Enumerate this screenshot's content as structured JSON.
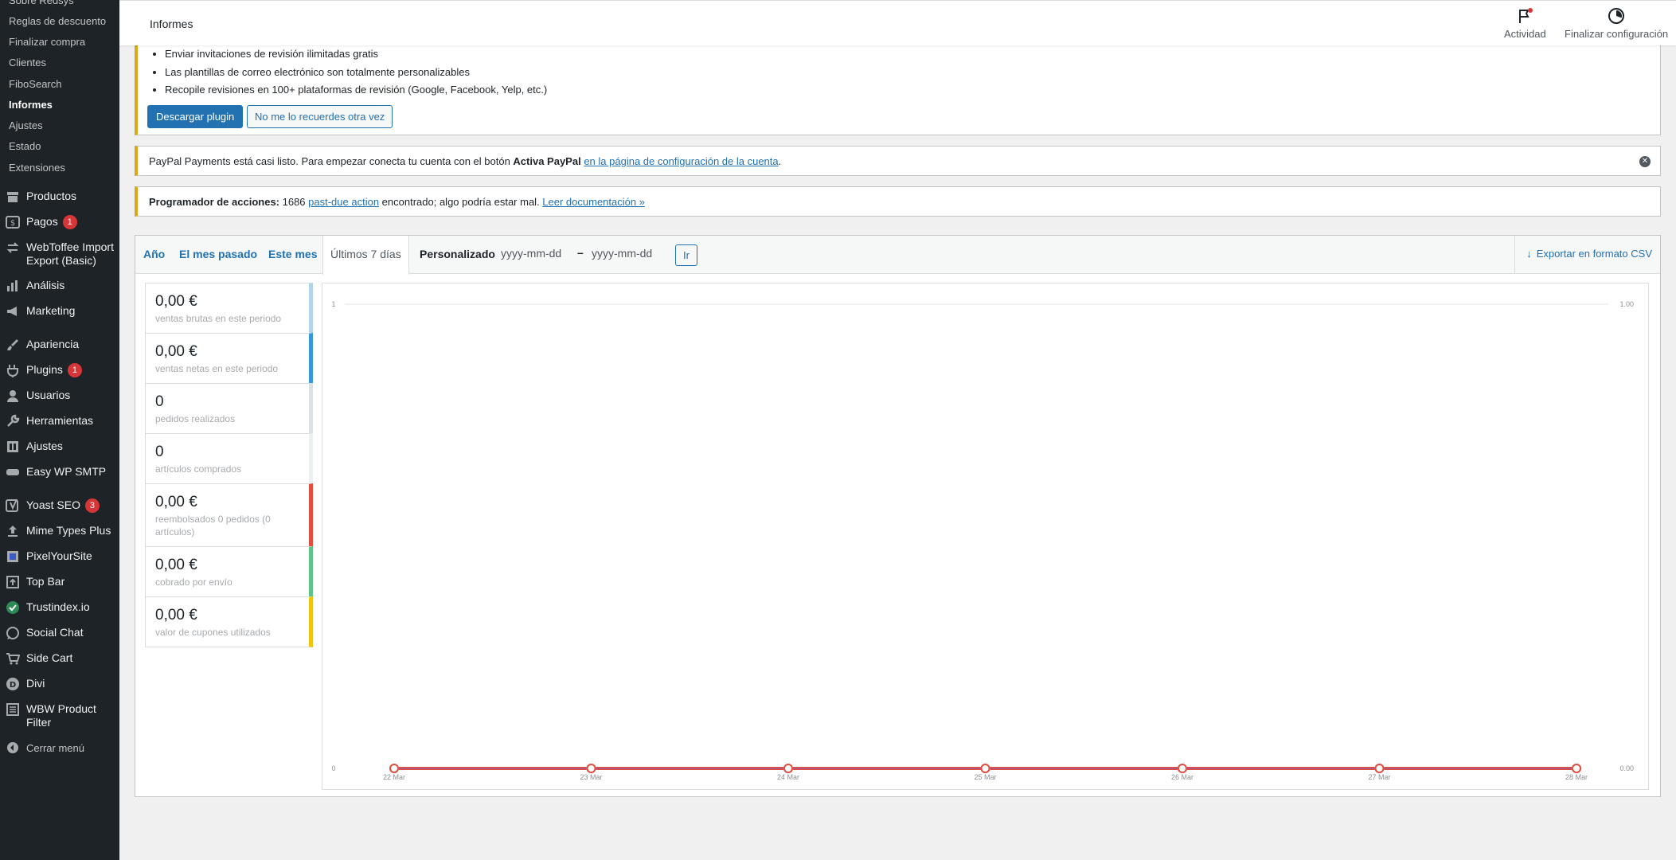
{
  "sidebar": {
    "submenu": [
      {
        "label": "Sobre Redsys"
      },
      {
        "label": "Reglas de descuento"
      },
      {
        "label": "Finalizar compra"
      },
      {
        "label": "Clientes"
      },
      {
        "label": "FiboSearch"
      },
      {
        "label": "Informes"
      },
      {
        "label": "Ajustes"
      },
      {
        "label": "Estado"
      },
      {
        "label": "Extensiones"
      }
    ],
    "menu": [
      {
        "label": "Productos",
        "icon": "products-icon"
      },
      {
        "label": "Pagos",
        "icon": "payments-icon",
        "badge": "1"
      },
      {
        "label": "WebToffee Import Export (Basic)",
        "icon": "import-export-icon"
      },
      {
        "label": "Análisis",
        "icon": "analytics-icon"
      },
      {
        "label": "Marketing",
        "icon": "megaphone-icon"
      },
      {
        "label": "Apariencia",
        "icon": "brush-icon"
      },
      {
        "label": "Plugins",
        "icon": "plug-icon",
        "badge": "1"
      },
      {
        "label": "Usuarios",
        "icon": "user-icon"
      },
      {
        "label": "Herramientas",
        "icon": "wrench-icon"
      },
      {
        "label": "Ajustes",
        "icon": "settings-icon"
      },
      {
        "label": "Easy WP SMTP",
        "icon": "smtp-icon"
      },
      {
        "label": "Yoast SEO",
        "icon": "yoast-icon",
        "badge": "3"
      },
      {
        "label": "Mime Types Plus",
        "icon": "upload-icon"
      },
      {
        "label": "PixelYourSite",
        "icon": "pixel-icon"
      },
      {
        "label": "Top Bar",
        "icon": "topbar-icon"
      },
      {
        "label": "Trustindex.io",
        "icon": "check-circle-icon"
      },
      {
        "label": "Social Chat",
        "icon": "whatsapp-icon"
      },
      {
        "label": "Side Cart",
        "icon": "cart-icon"
      },
      {
        "label": "Divi",
        "icon": "divi-icon"
      },
      {
        "label": "WBW Product Filter",
        "icon": "list-icon"
      }
    ],
    "collapse_label": "Cerrar menú"
  },
  "topbar": {
    "title": "Informes",
    "activity_label": "Actividad",
    "finish_setup_label": "Finalizar configuración"
  },
  "notice_review": {
    "bullets": [
      "Enviar invitaciones de revisión ilimitadas gratis",
      "Las plantillas de correo electrónico son totalmente personalizables",
      "Recopile revisiones en 100+ plataformas de revisión (Google, Facebook, Yelp, etc.)"
    ],
    "download_label": "Descargar plugin",
    "dismiss_label": "No me lo recuerdes otra vez"
  },
  "notice_paypal": {
    "text_before": "PayPal Payments está casi listo. Para empezar conecta tu cuenta con el botón ",
    "bold": "Activa PayPal",
    "space": " ",
    "link": "en la página de configuración de la cuenta",
    "text_after": "."
  },
  "notice_actions": {
    "bold": "Programador de acciones:",
    "text_before": " 1686 ",
    "link": "past-due action",
    "text_middle": " encontrado; algo podría estar mal. ",
    "doc_link": "Leer documentación »"
  },
  "report": {
    "tabs": [
      "Año",
      "El mes pasado",
      "Este mes",
      "Últimos 7 días"
    ],
    "custom_label": "Personalizado",
    "date_from_placeholder": "yyyy-mm-dd",
    "date_sep": "–",
    "date_to_placeholder": "yyyy-mm-dd",
    "go_label": "Ir",
    "export_label": "Exportar en formato CSV",
    "legend": [
      {
        "amount": "0,00 €",
        "desc": "ventas brutas en este periodo",
        "color": "#b1d4ea"
      },
      {
        "amount": "0,00 €",
        "desc": "ventas netas en este periodo",
        "color": "#3498db"
      },
      {
        "amount": "0",
        "desc": "pedidos realizados",
        "color": "#dbe1e3"
      },
      {
        "amount": "0",
        "desc": "artículos comprados",
        "color": "#ecf0f1"
      },
      {
        "amount": "0,00 €",
        "desc": "reembolsados 0 pedidos (0 artículos)",
        "color": "#e74c3c"
      },
      {
        "amount": "0,00 €",
        "desc": "cobrado por envío",
        "color": "#5cc488"
      },
      {
        "amount": "0,00 €",
        "desc": "valor de cupones utilizados",
        "color": "#f1c40f"
      }
    ]
  },
  "chart_data": {
    "type": "line",
    "x": [
      "22 Mar",
      "23 Mar",
      "24 Mar",
      "25 Mar",
      "26 Mar",
      "27 Mar",
      "28 Mar"
    ],
    "series": [
      {
        "name": "ventas brutas en este periodo",
        "values": [
          0,
          0,
          0,
          0,
          0,
          0,
          0
        ],
        "color": "#b1d4ea"
      },
      {
        "name": "ventas netas en este periodo",
        "values": [
          0,
          0,
          0,
          0,
          0,
          0,
          0
        ],
        "color": "#3498db"
      },
      {
        "name": "pedidos realizados",
        "values": [
          0,
          0,
          0,
          0,
          0,
          0,
          0
        ],
        "color": "#dbe1e3"
      },
      {
        "name": "artículos comprados",
        "values": [
          0,
          0,
          0,
          0,
          0,
          0,
          0
        ],
        "color": "#ecf0f1"
      },
      {
        "name": "reembolsados 0 pedidos (0 artículos)",
        "values": [
          0,
          0,
          0,
          0,
          0,
          0,
          0
        ],
        "color": "#e74c3c"
      }
    ],
    "y_left_ticks": [
      "1",
      "0"
    ],
    "y_right_ticks": [
      "1.00",
      "0.00"
    ],
    "ylim": [
      0,
      1
    ],
    "grid": true
  }
}
